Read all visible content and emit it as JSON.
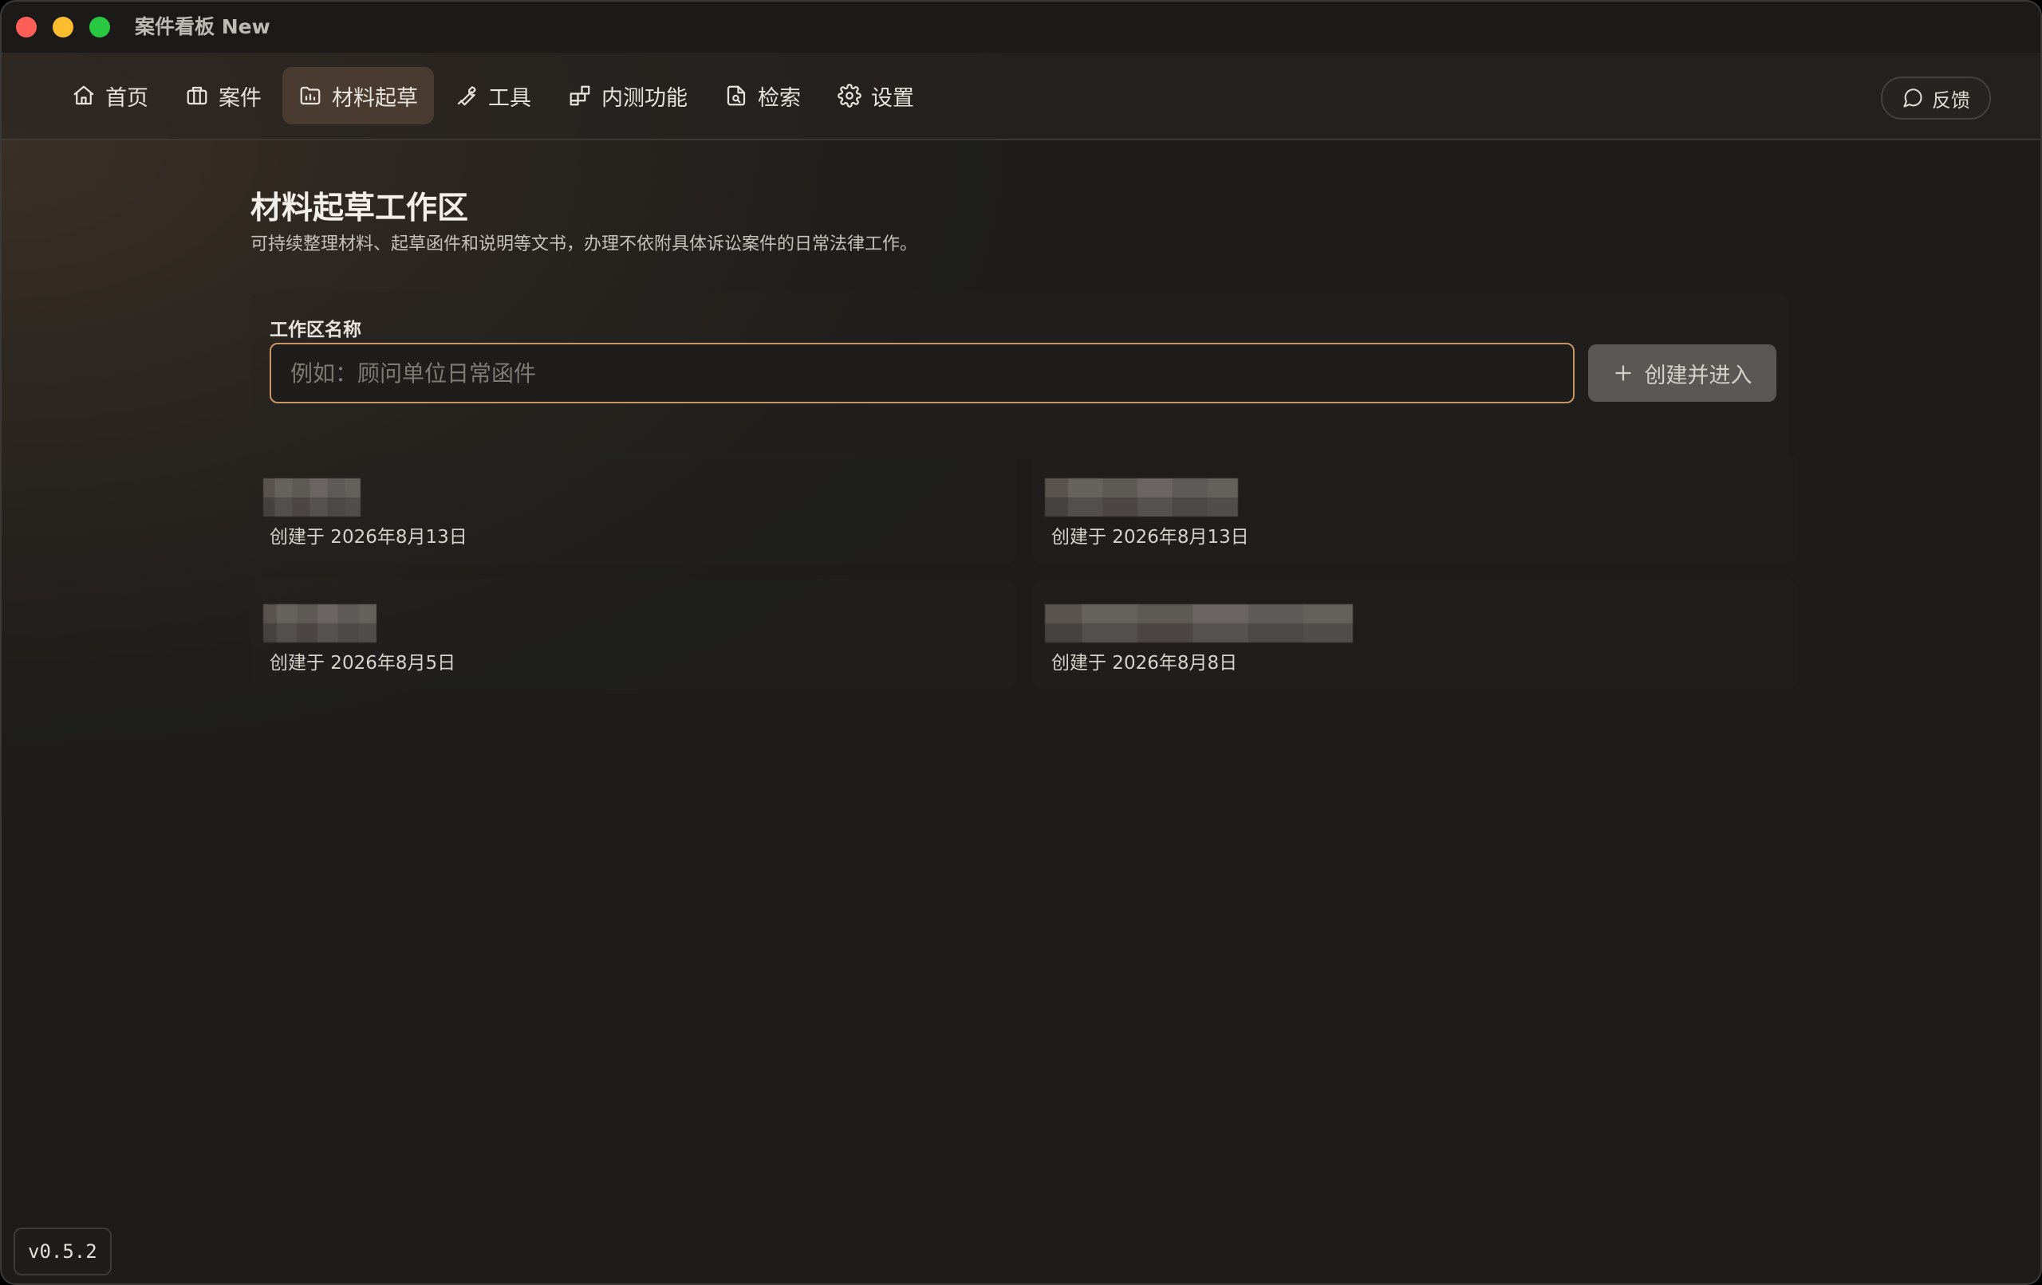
{
  "window": {
    "title": "案件看板 New"
  },
  "nav": {
    "items": [
      {
        "label": "首页",
        "icon": "home-icon"
      },
      {
        "label": "案件",
        "icon": "briefcase-icon"
      },
      {
        "label": "材料起草",
        "icon": "folder-chart-icon"
      },
      {
        "label": "工具",
        "icon": "wrench-icon"
      },
      {
        "label": "内测功能",
        "icon": "blocks-icon"
      },
      {
        "label": "检索",
        "icon": "file-search-icon"
      },
      {
        "label": "设置",
        "icon": "gear-icon"
      }
    ],
    "active_index": 2,
    "feedback_label": "反馈"
  },
  "page": {
    "title": "材料起草工作区",
    "description": "可持续整理材料、起草函件和说明等文书，办理不依附具体诉讼案件的日常法律工作。"
  },
  "create": {
    "label": "工作区名称",
    "placeholder": "例如：顾问单位日常函件",
    "value": "",
    "button_label": "创建并进入"
  },
  "workspaces": [
    {
      "name": "",
      "name_redacted": true,
      "created": "创建于 2026年8月13日"
    },
    {
      "name": "",
      "name_redacted": true,
      "created": "创建于 2026年8月13日"
    },
    {
      "name": "",
      "name_redacted": true,
      "created": "创建于 2026年8月5日"
    },
    {
      "name": "",
      "name_redacted": true,
      "created": "创建于 2026年8月8日"
    }
  ],
  "version": "v0.5.2",
  "colors": {
    "accent_border": "#c89665",
    "active_tab_bg": "#4a3b30",
    "button_bg": "#5a5854"
  }
}
